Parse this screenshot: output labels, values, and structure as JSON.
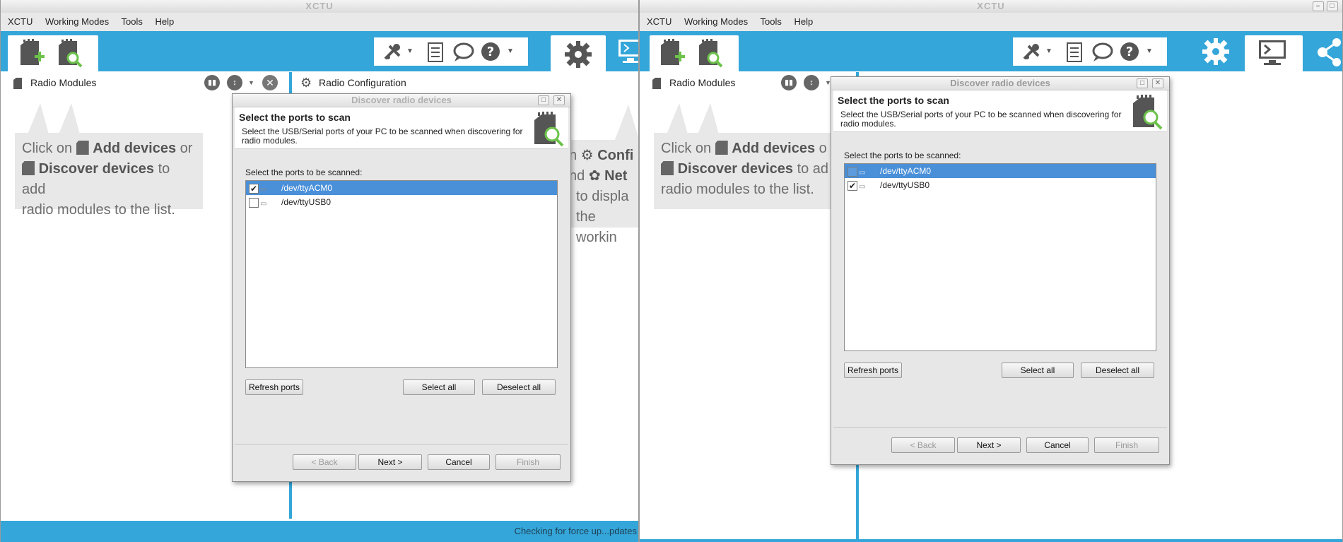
{
  "left": {
    "title": "XCTU",
    "menu": [
      "XCTU",
      "Working Modes",
      "Tools",
      "Help"
    ],
    "radio_modules_label": "Radio Modules",
    "radio_config_label": "Radio Configuration",
    "hint": {
      "click_on": "Click on",
      "add_devices": "Add devices",
      "or": "or",
      "discover_devices": "Discover devices",
      "to_add": "to add",
      "line3": "radio modules to the list."
    },
    "right_hint": {
      "line1_a": "n",
      "line1_b": "Confi",
      "line2_a": "nd",
      "line2_b": "Net",
      "line3": "to displa",
      "line4": "the workin"
    },
    "status": "Checking for force up...pdates",
    "dialog": {
      "title": "Discover radio devices",
      "heading": "Select the ports to scan",
      "description": "Select the USB/Serial ports of your PC to be scanned when discovering for radio modules.",
      "ports_label": "Select the ports to be scanned:",
      "ports": [
        {
          "name": "/dev/ttyACM0",
          "checked": true,
          "selected": true
        },
        {
          "name": "/dev/ttyUSB0",
          "checked": false,
          "selected": false
        }
      ],
      "refresh": "Refresh ports",
      "select_all": "Select all",
      "deselect_all": "Deselect all",
      "back": "< Back",
      "next": "Next >",
      "cancel": "Cancel",
      "finish": "Finish"
    }
  },
  "right": {
    "title": "XCTU",
    "menu": [
      "XCTU",
      "Working Modes",
      "Tools",
      "Help"
    ],
    "radio_modules_label": "Radio Modules",
    "hint": {
      "click_on": "Click on",
      "add_devices": "Add devices",
      "or": "o",
      "discover_devices": "Discover devices",
      "to_add": "to ad",
      "line3": "radio modules to the list."
    },
    "dialog": {
      "title": "Discover radio devices",
      "heading": "Select the ports to scan",
      "description": "Select the USB/Serial ports of your PC to be scanned when discovering for radio modules.",
      "ports_label": "Select the ports to be scanned:",
      "ports": [
        {
          "name": "/dev/ttyACM0",
          "checked": false,
          "selected": true
        },
        {
          "name": "/dev/ttyUSB0",
          "checked": true,
          "selected": false
        }
      ],
      "refresh": "Refresh ports",
      "select_all": "Select all",
      "deselect_all": "Deselect all",
      "back": "< Back",
      "next": "Next >",
      "cancel": "Cancel",
      "finish": "Finish"
    }
  },
  "colors": {
    "accent": "#34a6d9",
    "selection": "#4a90d9",
    "icon_dark": "#555555",
    "icon_green": "#6cc24a"
  }
}
